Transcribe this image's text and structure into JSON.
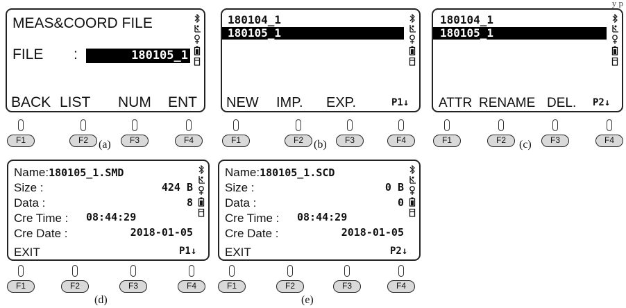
{
  "corner_text": "y p",
  "function_keys": [
    "F1",
    "F2",
    "F3",
    "F4"
  ],
  "panels": {
    "a": {
      "caption": "(a)",
      "title": "MEAS&COORD FILE",
      "file_label": "FILE",
      "file_colon": ":",
      "file_value": "180105_1",
      "softkeys": [
        "BACK",
        "LIST",
        "NUM",
        "ENT"
      ]
    },
    "b": {
      "caption": "(b)",
      "files": [
        "180104_1",
        "180105_1"
      ],
      "softkeys": [
        "NEW",
        "IMP.",
        "EXP."
      ],
      "page": "P1↓"
    },
    "c": {
      "caption": "(c)",
      "files": [
        "180104_1",
        "180105_1"
      ],
      "softkeys": [
        "ATTR",
        "RENAME",
        "DEL."
      ],
      "page": "P2↓"
    },
    "d": {
      "caption": "(d)",
      "name_label": "Name:",
      "name_value": "180105_1.SMD",
      "size_label": "Size :",
      "size_value": "424 B",
      "data_label": "Data :",
      "data_value": "8",
      "time_label": "Cre Time :",
      "time_value": "08:44:29",
      "date_label": "Cre Date :",
      "date_value": "2018-01-05",
      "exit": "EXIT",
      "page": "P1↓"
    },
    "e": {
      "caption": "(e)",
      "name_label": "Name:",
      "name_value": "180105_1.SCD",
      "size_label": "Size :",
      "size_value": "0 B",
      "data_label": "Data :",
      "data_value": "0",
      "time_label": "Cre Time :",
      "time_value": "08:44:29",
      "date_label": "Cre Date :",
      "date_value": "2018-01-05",
      "exit": "EXIT",
      "page": "P2↓"
    }
  },
  "icons": [
    "bluetooth-icon",
    "antenna-icon",
    "plumb-icon",
    "battery-icon",
    "memory-card-icon"
  ]
}
